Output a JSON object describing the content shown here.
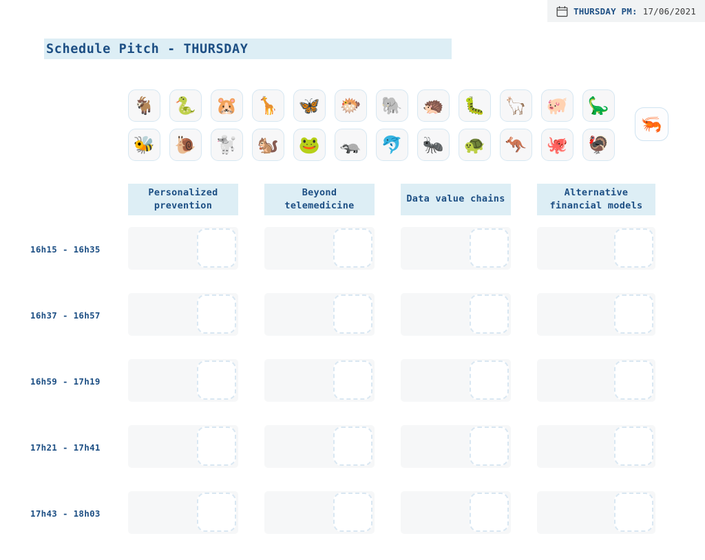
{
  "header": {
    "calendar_icon": "calendar-icon",
    "day_label": "THURSDAY PM:",
    "date": "17/06/2021",
    "badge_bg": "#f1f3f4",
    "accent_color": "#1d4f84"
  },
  "title": {
    "text": "Schedule Pitch - THURSDAY",
    "highlight_bg": "#ddeef5"
  },
  "avatars": {
    "row1": [
      {
        "name": "avatar-goat",
        "glyph": "🐐"
      },
      {
        "name": "avatar-snake",
        "glyph": "🐍"
      },
      {
        "name": "avatar-hamster",
        "glyph": "🐹"
      },
      {
        "name": "avatar-giraffe",
        "glyph": "🦒"
      },
      {
        "name": "avatar-butterfly",
        "glyph": "🦋"
      },
      {
        "name": "avatar-blowfish",
        "glyph": "🐡"
      },
      {
        "name": "avatar-elephant",
        "glyph": "🐘"
      },
      {
        "name": "avatar-hedgehog",
        "glyph": "🦔"
      },
      {
        "name": "avatar-caterpillar",
        "glyph": "🐛"
      },
      {
        "name": "avatar-llama",
        "glyph": "🦙"
      },
      {
        "name": "avatar-pig",
        "glyph": "🐖"
      },
      {
        "name": "avatar-sauropod",
        "glyph": "🦕"
      }
    ],
    "row2": [
      {
        "name": "avatar-bee",
        "glyph": "🐝"
      },
      {
        "name": "avatar-snail",
        "glyph": "🐌"
      },
      {
        "name": "avatar-poodle",
        "glyph": "🐩"
      },
      {
        "name": "avatar-chipmunk",
        "glyph": "🐿️"
      },
      {
        "name": "avatar-frog",
        "glyph": "🐸"
      },
      {
        "name": "avatar-badger",
        "glyph": "🦡"
      },
      {
        "name": "avatar-dolphin",
        "glyph": "🐬"
      },
      {
        "name": "avatar-ant",
        "glyph": "🐜"
      },
      {
        "name": "avatar-turtle",
        "glyph": "🐢"
      },
      {
        "name": "avatar-kangaroo",
        "glyph": "🦘"
      },
      {
        "name": "avatar-octopus",
        "glyph": "🐙"
      },
      {
        "name": "avatar-turkey",
        "glyph": "🦃"
      }
    ],
    "selected": {
      "name": "avatar-shrimp-selected",
      "glyph": "🦐"
    }
  },
  "schedule": {
    "columns": [
      {
        "label": "Personalized prevention"
      },
      {
        "label": "Beyond telemedicine"
      },
      {
        "label": "Data value chains"
      },
      {
        "label": "Alternative financial models"
      }
    ],
    "rows": [
      {
        "time": "16h15 - 16h35"
      },
      {
        "time": "16h37 - 16h57"
      },
      {
        "time": "16h59 - 17h19"
      },
      {
        "time": "17h21 - 17h41"
      },
      {
        "time": "17h43 - 18h03"
      }
    ],
    "cell_bg": "#f6f7f8",
    "dropzone_border": "#d9e7f2"
  }
}
